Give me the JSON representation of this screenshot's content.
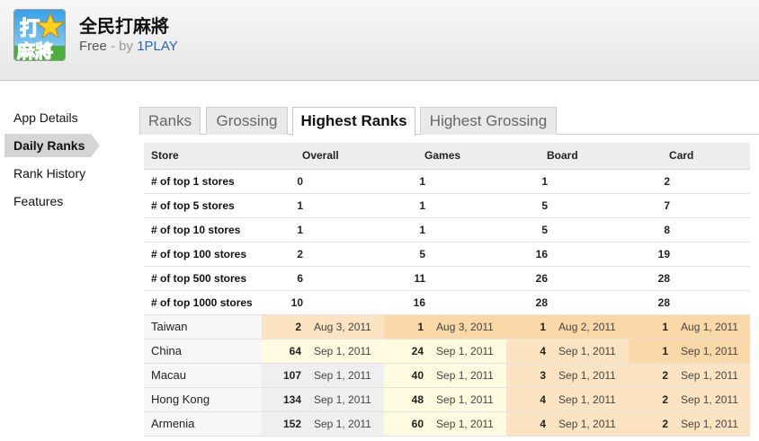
{
  "header": {
    "app_title": "全民打麻將",
    "price": "Free",
    "by_prefix": "- by",
    "developer": "1PLAY",
    "icon_text_top": "打",
    "icon_text_bottom": "麻將"
  },
  "nav": {
    "items": [
      {
        "label": "App Details",
        "active": false
      },
      {
        "label": "Daily Ranks",
        "active": true
      },
      {
        "label": "Rank History",
        "active": false
      },
      {
        "label": "Features",
        "active": false
      }
    ]
  },
  "tabs": [
    {
      "label": "Ranks",
      "active": false
    },
    {
      "label": "Grossing",
      "active": false
    },
    {
      "label": "Highest Ranks",
      "active": true
    },
    {
      "label": "Highest Grossing",
      "active": false
    }
  ],
  "table": {
    "headers": [
      "Store",
      "Overall",
      "Games",
      "Board",
      "Card"
    ],
    "stats": [
      {
        "label": "# of top 1 stores",
        "values": [
          "0",
          "1",
          "1",
          "2"
        ]
      },
      {
        "label": "# of top 5 stores",
        "values": [
          "1",
          "1",
          "5",
          "7"
        ]
      },
      {
        "label": "# of top 10 stores",
        "values": [
          "1",
          "1",
          "5",
          "8"
        ]
      },
      {
        "label": "# of top 100 stores",
        "values": [
          "2",
          "5",
          "16",
          "19"
        ]
      },
      {
        "label": "# of top 500 stores",
        "values": [
          "6",
          "11",
          "26",
          "28"
        ]
      },
      {
        "label": "# of top 1000 stores",
        "values": [
          "10",
          "16",
          "28",
          "28"
        ]
      }
    ],
    "countries": [
      {
        "name": "Taiwan",
        "cells": [
          {
            "rank": "2",
            "date": "Aug 3, 2011"
          },
          {
            "rank": "1",
            "date": "Aug 3, 2011"
          },
          {
            "rank": "1",
            "date": "Aug 2, 2011"
          },
          {
            "rank": "1",
            "date": "Aug 1, 2011"
          }
        ]
      },
      {
        "name": "China",
        "cells": [
          {
            "rank": "64",
            "date": "Sep 1, 2011"
          },
          {
            "rank": "24",
            "date": "Sep 1, 2011"
          },
          {
            "rank": "4",
            "date": "Sep 1, 2011"
          },
          {
            "rank": "1",
            "date": "Sep 1, 2011"
          }
        ]
      },
      {
        "name": "Macau",
        "cells": [
          {
            "rank": "107",
            "date": "Sep 1, 2011"
          },
          {
            "rank": "40",
            "date": "Sep 1, 2011"
          },
          {
            "rank": "3",
            "date": "Sep 1, 2011"
          },
          {
            "rank": "2",
            "date": "Sep 1, 2011"
          }
        ]
      },
      {
        "name": "Hong Kong",
        "cells": [
          {
            "rank": "134",
            "date": "Sep 1, 2011"
          },
          {
            "rank": "48",
            "date": "Sep 1, 2011"
          },
          {
            "rank": "4",
            "date": "Sep 1, 2011"
          },
          {
            "rank": "2",
            "date": "Sep 1, 2011"
          }
        ]
      },
      {
        "name": "Armenia",
        "cells": [
          {
            "rank": "152",
            "date": "Sep 1, 2011"
          },
          {
            "rank": "60",
            "date": "Sep 1, 2011"
          },
          {
            "rank": "4",
            "date": "Sep 1, 2011"
          },
          {
            "rank": "2",
            "date": "Sep 1, 2011"
          }
        ]
      }
    ]
  },
  "colors": {
    "rank_top1": "#fbd8a8",
    "rank_top5": "#fce4c2",
    "rank_top10": "#fff0d6",
    "rank_top100": "#fffbe0",
    "rank_other": "#efefef",
    "link": "#2a63b8"
  }
}
